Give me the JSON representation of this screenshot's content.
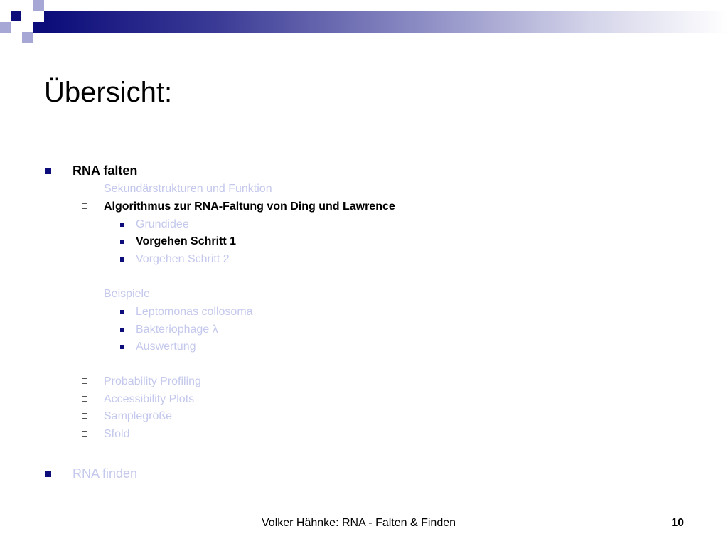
{
  "slide": {
    "title": "Übersicht:",
    "items": [
      {
        "level": 1,
        "text": "RNA falten",
        "state": "active"
      },
      {
        "level": 2,
        "text": "Sekundärstrukturen und Funktion",
        "state": "dim"
      },
      {
        "level": 2,
        "text": "Algorithmus zur RNA-Faltung von Ding und Lawrence",
        "state": "active"
      },
      {
        "level": 3,
        "text": "Grundidee",
        "state": "dim"
      },
      {
        "level": 3,
        "text": "Vorgehen Schritt 1",
        "state": "active"
      },
      {
        "level": 3,
        "text": "Vorgehen Schritt 2",
        "state": "dim"
      },
      {
        "level": 2,
        "text": "Beispiele",
        "state": "dim"
      },
      {
        "level": 3,
        "text": "Leptomonas collosoma",
        "state": "dim"
      },
      {
        "level": 3,
        "text": "Bakteriophage λ",
        "state": "dim"
      },
      {
        "level": 3,
        "text": "Auswertung",
        "state": "dim"
      },
      {
        "level": 2,
        "text": "Probability Profiling",
        "state": "dim"
      },
      {
        "level": 2,
        "text": "Accessibility Plots",
        "state": "dim"
      },
      {
        "level": 2,
        "text": "Samplegröße",
        "state": "dim"
      },
      {
        "level": 2,
        "text": "Sfold",
        "state": "dim"
      },
      {
        "level": 1,
        "text": "RNA finden",
        "state": "dim"
      }
    ],
    "footer": "Volker Hähnke: RNA - Falten & Finden",
    "page_number": "10"
  },
  "colors": {
    "accent": "#0c0c7a",
    "accent_light": "#a7a7d6",
    "dim_text": "#c4c8ec",
    "active_text": "#000000"
  }
}
